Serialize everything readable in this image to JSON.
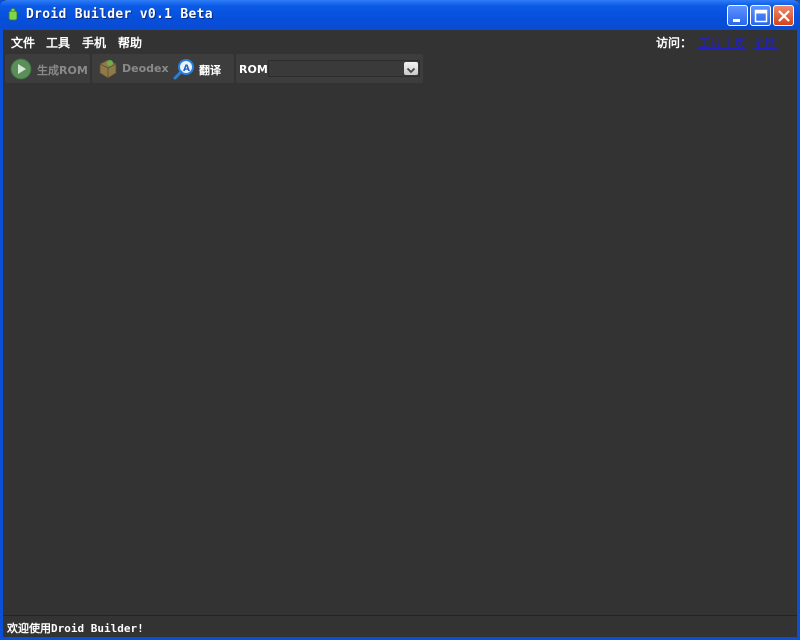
{
  "window": {
    "title": "Droid Builder v0.1 Beta",
    "icon": "android-icon"
  },
  "title_buttons": {
    "minimize": "minimize-icon",
    "maximize": "maximize-icon",
    "close": "close-icon"
  },
  "menu": {
    "items": [
      "文件",
      "工具",
      "手机",
      "帮助"
    ],
    "visit_label": "访问：",
    "links": [
      "工具主页",
      "捐助"
    ]
  },
  "toolbar": {
    "build_rom": {
      "label": "生成ROM",
      "icon": "play-icon",
      "enabled": false
    },
    "deodex": {
      "label": "Deodex",
      "icon": "package-icon",
      "enabled": false
    },
    "translate": {
      "label": "翻译",
      "icon": "translate-magnifier-icon",
      "enabled": true
    },
    "rom_label": "ROM：",
    "rom_value": ""
  },
  "status": {
    "text": "欢迎使用Droid Builder!"
  },
  "colors": {
    "titlebar": "#0b5ae6",
    "background": "#333333",
    "link": "#2020c8"
  }
}
